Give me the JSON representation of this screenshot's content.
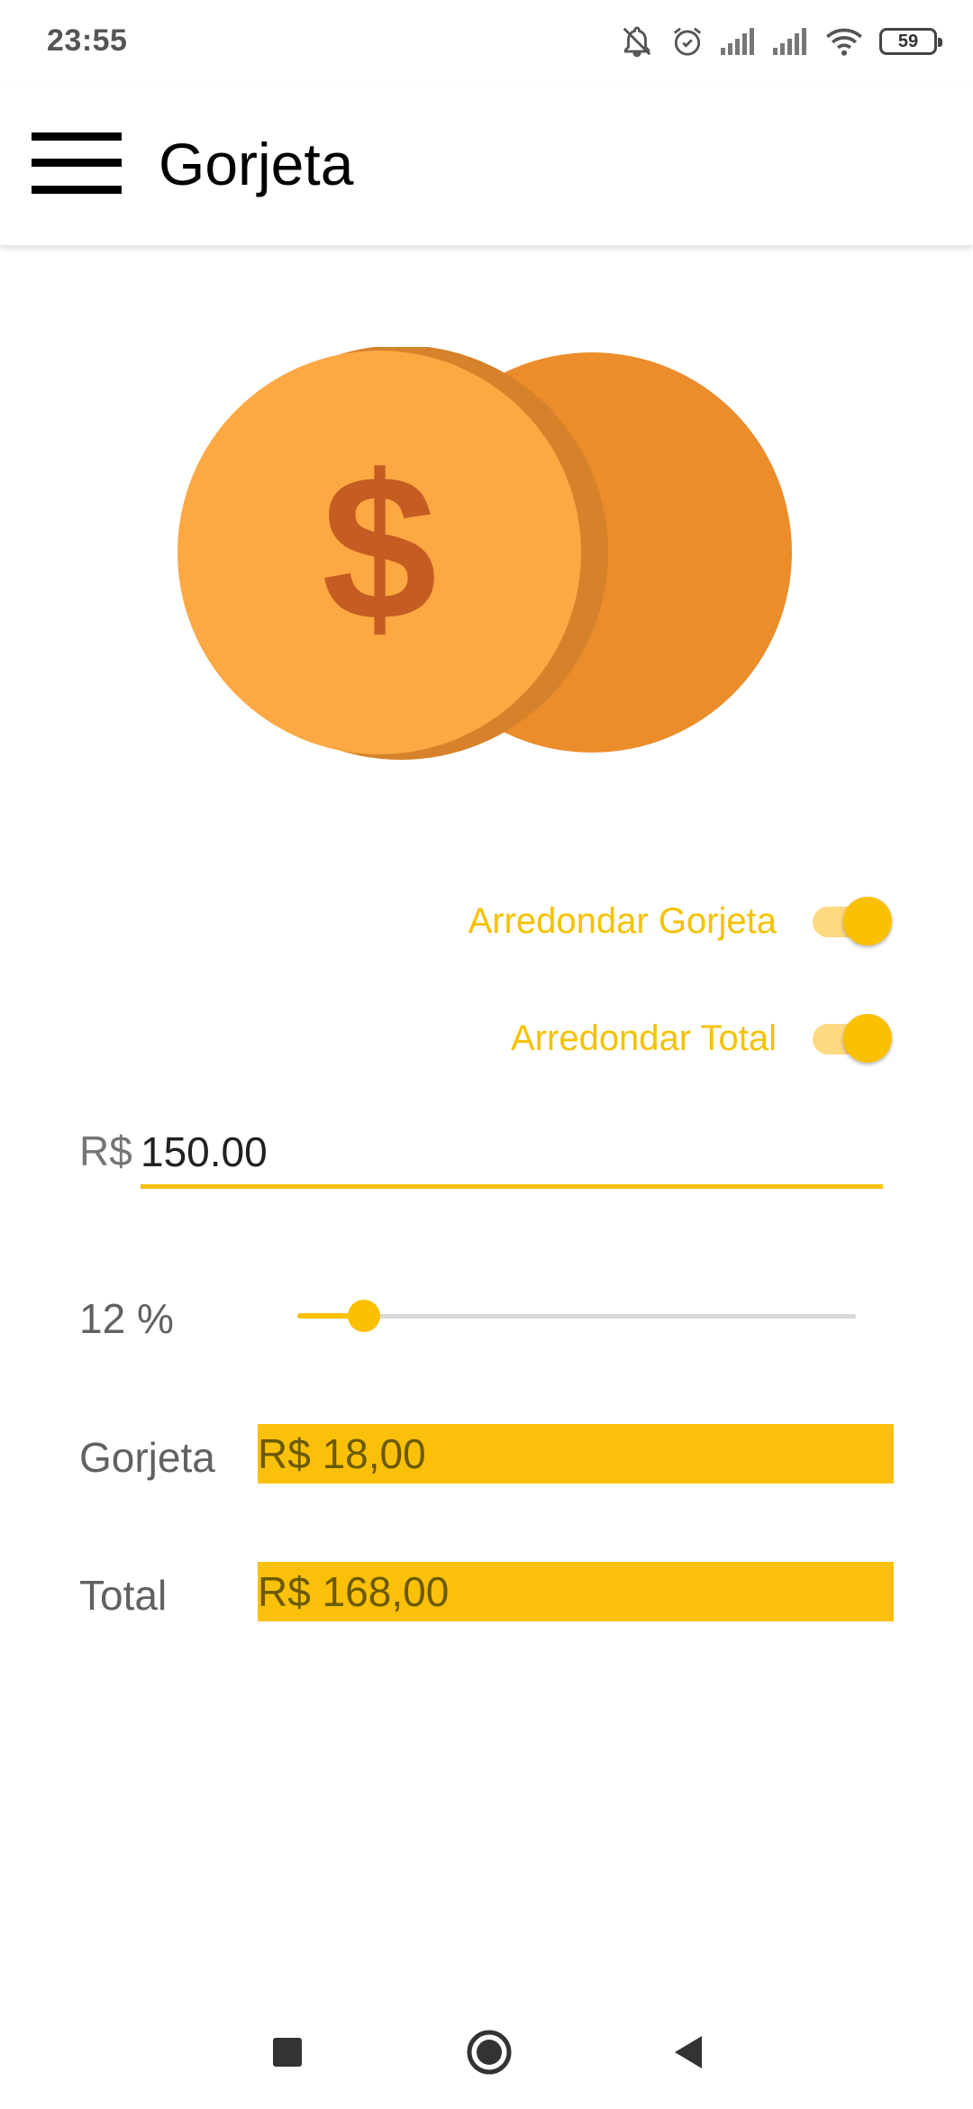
{
  "status_bar": {
    "time": "23:55",
    "battery": "59",
    "icons": [
      "notifications-off-icon",
      "alarm-icon",
      "signal-icon",
      "signal-icon",
      "wifi-icon",
      "battery-icon"
    ]
  },
  "app_bar": {
    "menu_icon": "menu-icon",
    "title": "Gorjeta"
  },
  "illustration": {
    "icon": "coins-icon",
    "symbol": "$",
    "colors": {
      "front_coin": "#FDA843",
      "back_coin": "#EA8D2A",
      "coin_edge": "#D6822A",
      "dollar": "#C55C22"
    }
  },
  "options": {
    "round_tip": {
      "label": "Arredondar Gorjeta",
      "checked": true
    },
    "round_total": {
      "label": "Arredondar Total",
      "checked": true
    }
  },
  "amount": {
    "prefix": "R$",
    "value": "150.00"
  },
  "tip_percent": {
    "label": "12 %",
    "value": 12,
    "fraction": 0.12
  },
  "results": {
    "tip": {
      "label": "Gorjeta",
      "value": "R$ 18,00"
    },
    "total": {
      "label": "Total",
      "value": "R$ 168,00"
    }
  },
  "navigation": {
    "recents": "recents-icon",
    "home": "home-icon",
    "back": "back-icon"
  },
  "colors": {
    "accent": "#FBC000",
    "accent_light": "#FDD980",
    "result_background": "#FBC10A"
  }
}
